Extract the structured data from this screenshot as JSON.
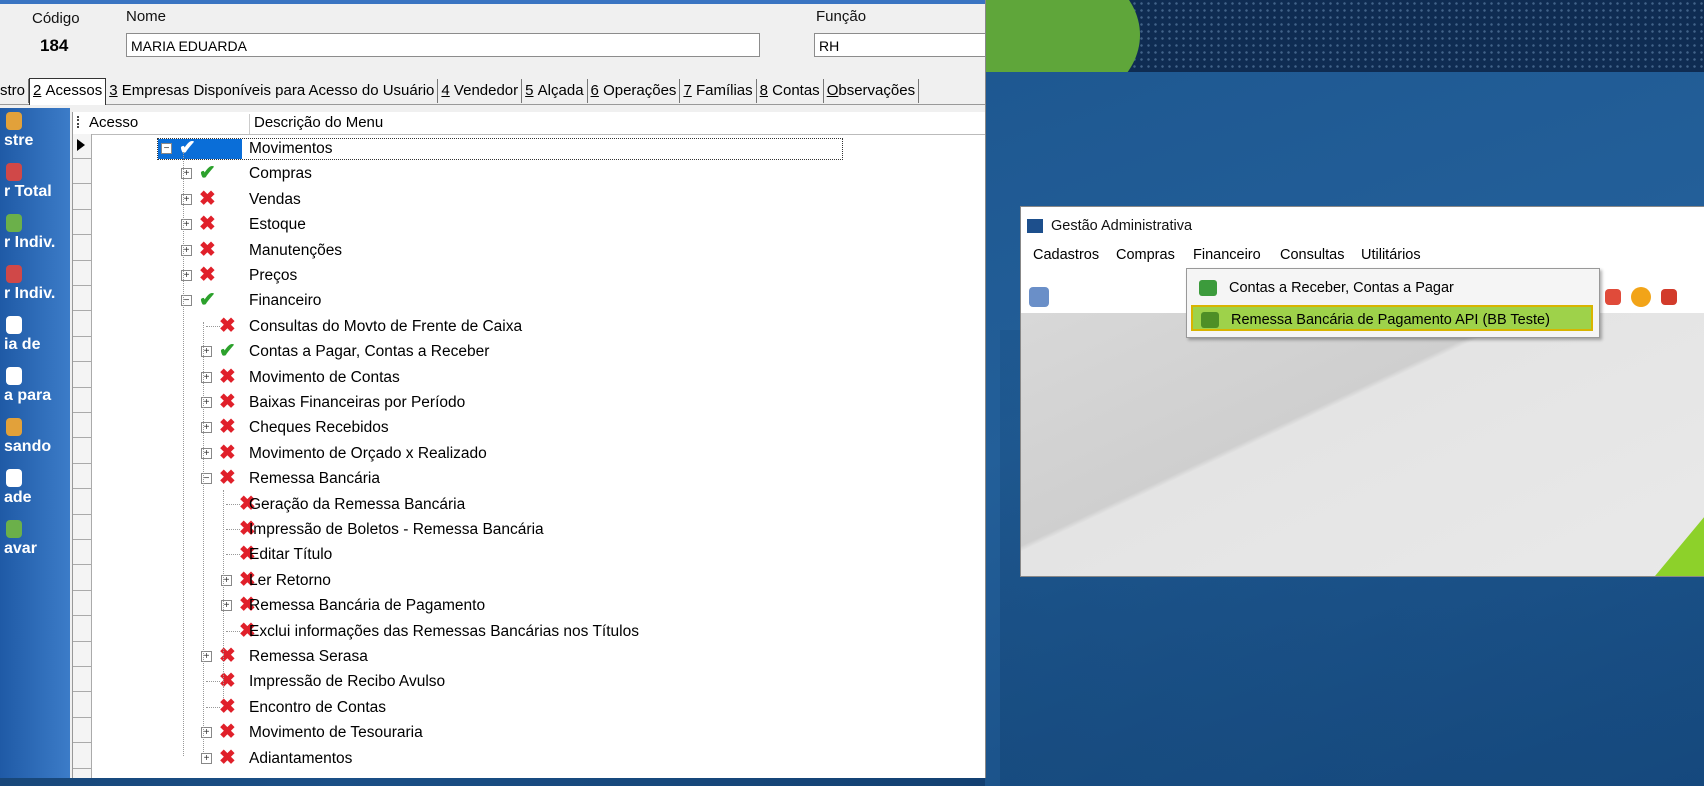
{
  "user_form": {
    "code_label": "Código",
    "code_value": "184",
    "name_label": "Nome",
    "name_value": "MARIA EDUARDA",
    "function_label": "Função",
    "function_value": "RH"
  },
  "tabs": [
    {
      "label": "stro",
      "underline": ""
    },
    {
      "label": "Acessos",
      "underline": "2"
    },
    {
      "label": "Empresas Disponíveis para Acesso do Usuário",
      "underline": "3"
    },
    {
      "label": "Vendedor",
      "underline": "4"
    },
    {
      "label": "Alçada",
      "underline": "5"
    },
    {
      "label": "Operações",
      "underline": "6"
    },
    {
      "label": "Famílias",
      "underline": "7"
    },
    {
      "label": "Contas",
      "underline": "8"
    },
    {
      "label": "bservações",
      "underline": "O"
    }
  ],
  "left_toolbar": [
    {
      "text": "stre",
      "color": "#e2a13a"
    },
    {
      "text": "r Total",
      "color": "#d04848"
    },
    {
      "text": "r Indiv.",
      "color": "#6bb04a"
    },
    {
      "text": "r Indiv.",
      "color": "#d04848"
    },
    {
      "text": "ia de",
      "color": "#ffffff"
    },
    {
      "text": "a para",
      "color": "#ffffff"
    },
    {
      "text": "sando",
      "color": "#e2a13a"
    },
    {
      "text": "ade",
      "color": "#ffffff"
    },
    {
      "text": "avar",
      "color": "#6bb04a"
    }
  ],
  "grid": {
    "col_access": "Acesso",
    "col_description": "Descrição do Menu",
    "rows": [
      {
        "level": 0,
        "expander": "minus",
        "status": "ok",
        "label": "Movimentos",
        "selected": true
      },
      {
        "level": 1,
        "expander": "plus",
        "status": "ok",
        "label": "Compras"
      },
      {
        "level": 1,
        "expander": "plus",
        "status": "no",
        "label": "Vendas"
      },
      {
        "level": 1,
        "expander": "plus",
        "status": "no",
        "label": "Estoque"
      },
      {
        "level": 1,
        "expander": "plus",
        "status": "no",
        "label": "Manutenções"
      },
      {
        "level": 1,
        "expander": "plus",
        "status": "no",
        "label": "Preços"
      },
      {
        "level": 1,
        "expander": "minus",
        "status": "ok",
        "label": "Financeiro"
      },
      {
        "level": 2,
        "expander": "",
        "status": "no",
        "label": "Consultas do Movto de Frente de Caixa"
      },
      {
        "level": 2,
        "expander": "plus",
        "status": "ok",
        "label": "Contas a Pagar, Contas a Receber"
      },
      {
        "level": 2,
        "expander": "plus",
        "status": "no",
        "label": "Movimento de Contas"
      },
      {
        "level": 2,
        "expander": "plus",
        "status": "no",
        "label": "Baixas Financeiras por Período"
      },
      {
        "level": 2,
        "expander": "plus",
        "status": "no",
        "label": "Cheques Recebidos"
      },
      {
        "level": 2,
        "expander": "plus",
        "status": "no",
        "label": "Movimento de Orçado x Realizado"
      },
      {
        "level": 2,
        "expander": "minus",
        "status": "no",
        "label": "Remessa Bancária"
      },
      {
        "level": 3,
        "expander": "",
        "status": "no",
        "label": "Geração da Remessa Bancária"
      },
      {
        "level": 3,
        "expander": "",
        "status": "no",
        "label": "Impressão de Boletos - Remessa Bancária"
      },
      {
        "level": 3,
        "expander": "",
        "status": "no",
        "label": "Editar Título"
      },
      {
        "level": 3,
        "expander": "plus",
        "status": "no",
        "label": "Ler Retorno"
      },
      {
        "level": 3,
        "expander": "plus",
        "status": "no",
        "label": "Remessa Bancária de Pagamento"
      },
      {
        "level": 3,
        "expander": "",
        "status": "no",
        "label": "Exclui informações das Remessas Bancárias nos Títulos"
      },
      {
        "level": 2,
        "expander": "plus",
        "status": "no",
        "label": "Remessa Serasa"
      },
      {
        "level": 2,
        "expander": "",
        "status": "no",
        "label": "Impressão de Recibo Avulso"
      },
      {
        "level": 2,
        "expander": "",
        "status": "no",
        "label": "Encontro de Contas"
      },
      {
        "level": 2,
        "expander": "plus",
        "status": "no",
        "label": "Movimento de Tesouraria"
      },
      {
        "level": 2,
        "expander": "plus",
        "status": "no",
        "label": "Adiantamentos"
      }
    ]
  },
  "inset_app": {
    "title": "Gestão Administrativa",
    "menus": [
      "Cadastros",
      "Compras",
      "Financeiro",
      "Consultas",
      "Utilitários"
    ],
    "dropdown": [
      {
        "label": "Contas a Receber, Contas a Pagar",
        "highlighted": false
      },
      {
        "label": "Remessa Bancária de Pagamento API (BB Teste)",
        "highlighted": true
      }
    ]
  },
  "colors": {
    "accent_blue": "#0a6ed8",
    "ok_green": "#2ca12c",
    "deny_red": "#e0202a",
    "highlight_green": "#9ed24a"
  }
}
